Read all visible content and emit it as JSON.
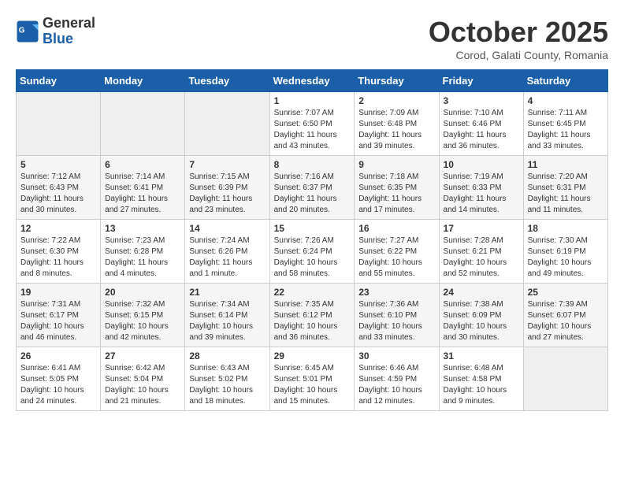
{
  "header": {
    "logo_general": "General",
    "logo_blue": "Blue",
    "title": "October 2025",
    "subtitle": "Corod, Galati County, Romania"
  },
  "weekdays": [
    "Sunday",
    "Monday",
    "Tuesday",
    "Wednesday",
    "Thursday",
    "Friday",
    "Saturday"
  ],
  "rows": [
    [
      {
        "day": "",
        "info": ""
      },
      {
        "day": "",
        "info": ""
      },
      {
        "day": "",
        "info": ""
      },
      {
        "day": "1",
        "info": "Sunrise: 7:07 AM\nSunset: 6:50 PM\nDaylight: 11 hours\nand 43 minutes."
      },
      {
        "day": "2",
        "info": "Sunrise: 7:09 AM\nSunset: 6:48 PM\nDaylight: 11 hours\nand 39 minutes."
      },
      {
        "day": "3",
        "info": "Sunrise: 7:10 AM\nSunset: 6:46 PM\nDaylight: 11 hours\nand 36 minutes."
      },
      {
        "day": "4",
        "info": "Sunrise: 7:11 AM\nSunset: 6:45 PM\nDaylight: 11 hours\nand 33 minutes."
      }
    ],
    [
      {
        "day": "5",
        "info": "Sunrise: 7:12 AM\nSunset: 6:43 PM\nDaylight: 11 hours\nand 30 minutes."
      },
      {
        "day": "6",
        "info": "Sunrise: 7:14 AM\nSunset: 6:41 PM\nDaylight: 11 hours\nand 27 minutes."
      },
      {
        "day": "7",
        "info": "Sunrise: 7:15 AM\nSunset: 6:39 PM\nDaylight: 11 hours\nand 23 minutes."
      },
      {
        "day": "8",
        "info": "Sunrise: 7:16 AM\nSunset: 6:37 PM\nDaylight: 11 hours\nand 20 minutes."
      },
      {
        "day": "9",
        "info": "Sunrise: 7:18 AM\nSunset: 6:35 PM\nDaylight: 11 hours\nand 17 minutes."
      },
      {
        "day": "10",
        "info": "Sunrise: 7:19 AM\nSunset: 6:33 PM\nDaylight: 11 hours\nand 14 minutes."
      },
      {
        "day": "11",
        "info": "Sunrise: 7:20 AM\nSunset: 6:31 PM\nDaylight: 11 hours\nand 11 minutes."
      }
    ],
    [
      {
        "day": "12",
        "info": "Sunrise: 7:22 AM\nSunset: 6:30 PM\nDaylight: 11 hours\nand 8 minutes."
      },
      {
        "day": "13",
        "info": "Sunrise: 7:23 AM\nSunset: 6:28 PM\nDaylight: 11 hours\nand 4 minutes."
      },
      {
        "day": "14",
        "info": "Sunrise: 7:24 AM\nSunset: 6:26 PM\nDaylight: 11 hours\nand 1 minute."
      },
      {
        "day": "15",
        "info": "Sunrise: 7:26 AM\nSunset: 6:24 PM\nDaylight: 10 hours\nand 58 minutes."
      },
      {
        "day": "16",
        "info": "Sunrise: 7:27 AM\nSunset: 6:22 PM\nDaylight: 10 hours\nand 55 minutes."
      },
      {
        "day": "17",
        "info": "Sunrise: 7:28 AM\nSunset: 6:21 PM\nDaylight: 10 hours\nand 52 minutes."
      },
      {
        "day": "18",
        "info": "Sunrise: 7:30 AM\nSunset: 6:19 PM\nDaylight: 10 hours\nand 49 minutes."
      }
    ],
    [
      {
        "day": "19",
        "info": "Sunrise: 7:31 AM\nSunset: 6:17 PM\nDaylight: 10 hours\nand 46 minutes."
      },
      {
        "day": "20",
        "info": "Sunrise: 7:32 AM\nSunset: 6:15 PM\nDaylight: 10 hours\nand 42 minutes."
      },
      {
        "day": "21",
        "info": "Sunrise: 7:34 AM\nSunset: 6:14 PM\nDaylight: 10 hours\nand 39 minutes."
      },
      {
        "day": "22",
        "info": "Sunrise: 7:35 AM\nSunset: 6:12 PM\nDaylight: 10 hours\nand 36 minutes."
      },
      {
        "day": "23",
        "info": "Sunrise: 7:36 AM\nSunset: 6:10 PM\nDaylight: 10 hours\nand 33 minutes."
      },
      {
        "day": "24",
        "info": "Sunrise: 7:38 AM\nSunset: 6:09 PM\nDaylight: 10 hours\nand 30 minutes."
      },
      {
        "day": "25",
        "info": "Sunrise: 7:39 AM\nSunset: 6:07 PM\nDaylight: 10 hours\nand 27 minutes."
      }
    ],
    [
      {
        "day": "26",
        "info": "Sunrise: 6:41 AM\nSunset: 5:05 PM\nDaylight: 10 hours\nand 24 minutes."
      },
      {
        "day": "27",
        "info": "Sunrise: 6:42 AM\nSunset: 5:04 PM\nDaylight: 10 hours\nand 21 minutes."
      },
      {
        "day": "28",
        "info": "Sunrise: 6:43 AM\nSunset: 5:02 PM\nDaylight: 10 hours\nand 18 minutes."
      },
      {
        "day": "29",
        "info": "Sunrise: 6:45 AM\nSunset: 5:01 PM\nDaylight: 10 hours\nand 15 minutes."
      },
      {
        "day": "30",
        "info": "Sunrise: 6:46 AM\nSunset: 4:59 PM\nDaylight: 10 hours\nand 12 minutes."
      },
      {
        "day": "31",
        "info": "Sunrise: 6:48 AM\nSunset: 4:58 PM\nDaylight: 10 hours\nand 9 minutes."
      },
      {
        "day": "",
        "info": ""
      }
    ]
  ]
}
